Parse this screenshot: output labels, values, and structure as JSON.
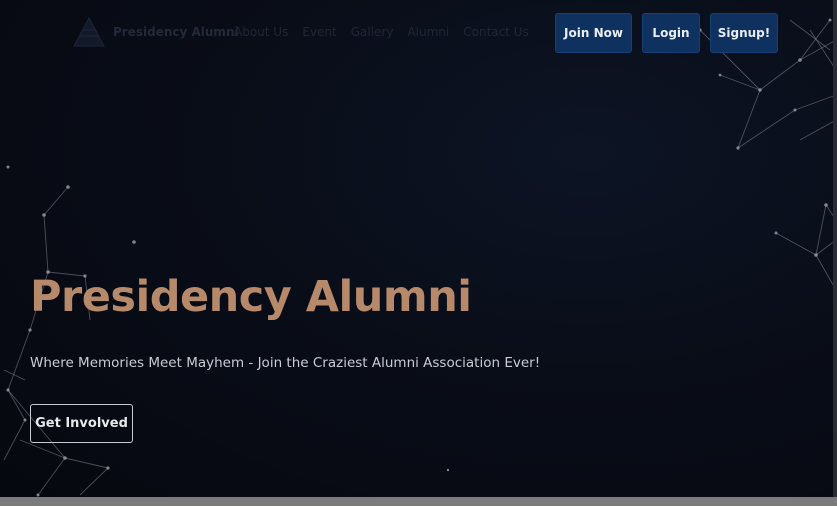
{
  "colors": {
    "background": "#080b14",
    "accent_title": "#b5896a",
    "button_bg": "#0e3160",
    "nav_text": "#1f2636"
  },
  "nav": {
    "logo_icon": "pyramid-logo-icon",
    "brand": "Presidency Alumni",
    "links": [
      "About Us",
      "Event",
      "Gallery",
      "Alumni",
      "Contact Us"
    ],
    "buttons": {
      "join": "Join Now",
      "login": "Login",
      "signup": "Signup!"
    }
  },
  "hero": {
    "title": "Presidency Alumni",
    "subtitle": "Where Memories Meet Mayhem - Join the Craziest Alumni Association Ever!",
    "cta": "Get Involved"
  }
}
